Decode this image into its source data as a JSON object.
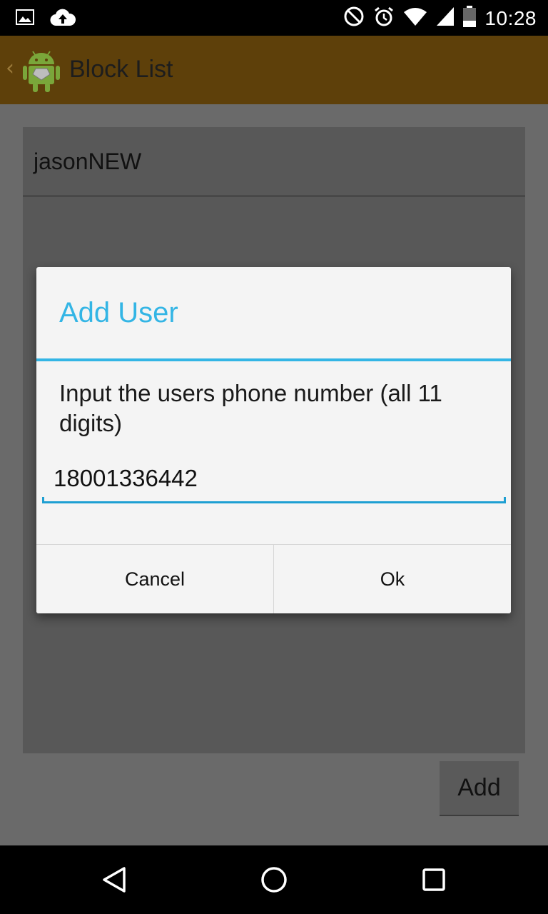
{
  "status_bar": {
    "time": "10:28",
    "left_icons": [
      "image-icon",
      "cloud-upload-icon"
    ],
    "right_icons": [
      "do-not-disturb-icon",
      "alarm-icon",
      "wifi-icon",
      "signal-icon",
      "battery-icon"
    ]
  },
  "action_bar": {
    "title": "Block List",
    "background": "#5e400a"
  },
  "list": {
    "items": [
      "jasonNEW"
    ]
  },
  "add_button": {
    "label": "Add"
  },
  "dialog": {
    "title": "Add User",
    "message": "Input the users phone number (all 11 digits)",
    "input_value": "18001336442",
    "cancel_label": "Cancel",
    "ok_label": "Ok",
    "accent_color": "#33b5e5"
  },
  "nav_bar": {
    "items": [
      "back-icon",
      "home-icon",
      "recents-icon"
    ]
  }
}
